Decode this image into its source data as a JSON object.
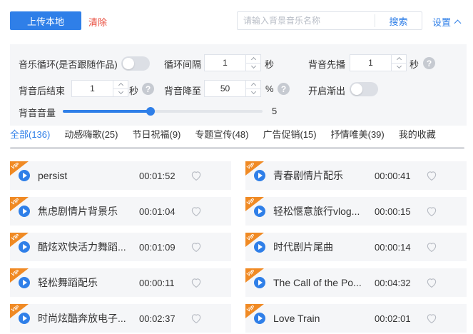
{
  "toolbar": {
    "upload_label": "上传本地",
    "clear_label": "清除",
    "search_placeholder": "请输入背景音乐名称",
    "search_label": "搜索",
    "settings_label": "设置"
  },
  "settings": {
    "loop_label": "音乐循环(是否跟随作品)",
    "loop_on": false,
    "interval_label": "循环间隔",
    "interval_value": "1",
    "interval_unit": "秒",
    "lead_label": "背音先播",
    "lead_value": "1",
    "lead_unit": "秒",
    "tail_label": "背音后结束",
    "tail_value": "1",
    "tail_unit": "秒",
    "duck_label": "背音降至",
    "duck_value": "50",
    "duck_unit": "%",
    "fade_label": "开启渐出",
    "fade_on": false,
    "volume_label": "背音音量",
    "volume_value": "5",
    "volume_fraction": 0.44,
    "help_glyph": "?"
  },
  "tabs": [
    {
      "label": "全部(136)",
      "active": true
    },
    {
      "label": "动感嗨歌(25)",
      "active": false
    },
    {
      "label": "节日祝福(9)",
      "active": false
    },
    {
      "label": "专题宣传(48)",
      "active": false
    },
    {
      "label": "广告促销(15)",
      "active": false
    },
    {
      "label": "抒情唯美(39)",
      "active": false
    },
    {
      "label": "我的收藏",
      "active": false
    }
  ],
  "tracks": [
    {
      "title": "persist",
      "duration": "00:01:52",
      "vip": "VIP"
    },
    {
      "title": "青春剧情片配乐",
      "duration": "00:00:41",
      "vip": "VIP"
    },
    {
      "title": "焦虑剧情片背景乐",
      "duration": "00:01:04",
      "vip": "VIP"
    },
    {
      "title": "轻松惬意旅行vlog...",
      "duration": "00:00:15",
      "vip": "VIP"
    },
    {
      "title": "酷炫欢快活力舞蹈...",
      "duration": "00:01:09",
      "vip": "VIP"
    },
    {
      "title": "时代剧片尾曲",
      "duration": "00:00:14",
      "vip": "VIP"
    },
    {
      "title": "轻松舞蹈配乐",
      "duration": "00:00:11",
      "vip": "VIP"
    },
    {
      "title": "The Call of the Po...",
      "duration": "00:04:32",
      "vip": "VIP"
    },
    {
      "title": "时尚炫酷奔放电子...",
      "duration": "00:02:37",
      "vip": "VIP"
    },
    {
      "title": "Love Train",
      "duration": "00:02:01",
      "vip": "VIP"
    }
  ],
  "colors": {
    "accent": "#2f7fe8",
    "danger": "#e84b3c",
    "vip": "#f08a24"
  },
  "icons": {
    "play": "play-icon",
    "favorite": "heart-outline-icon",
    "settings_toggle": "chevron-up-icon",
    "help": "question-circle-icon"
  }
}
